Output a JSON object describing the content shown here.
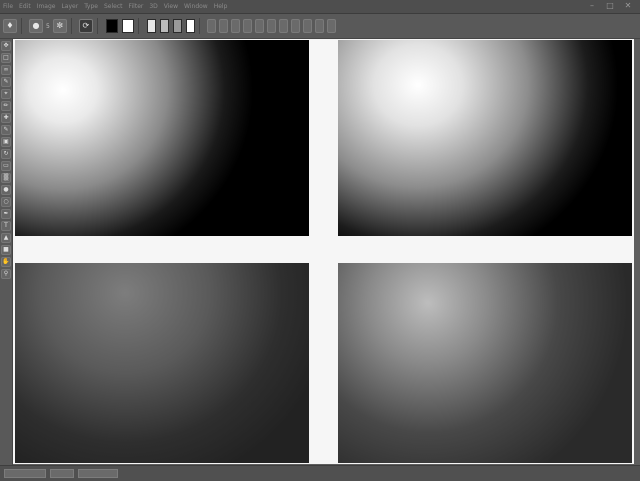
{
  "menubar": {
    "items": [
      "File",
      "Edit",
      "Image",
      "Layer",
      "Type",
      "Select",
      "Filter",
      "3D",
      "View",
      "Window",
      "Help"
    ]
  },
  "window_controls": {
    "minimize": "–",
    "maximize": "□",
    "close": "✕"
  },
  "optionsbar": {
    "tool_icon": "brush-icon",
    "size_label": "5",
    "swatches": {
      "foreground": "#ffffff",
      "background": "#000000"
    }
  },
  "toolbar": {
    "tools": [
      "move",
      "marquee",
      "lasso",
      "quick-select",
      "crop",
      "eyedropper",
      "healing",
      "brush",
      "stamp",
      "history",
      "eraser",
      "gradient",
      "blur",
      "dodge",
      "pen",
      "type",
      "path-select",
      "shape",
      "hand",
      "zoom"
    ]
  },
  "canvas": {
    "panels": [
      "top-left",
      "top-right",
      "bottom-left",
      "bottom-right"
    ],
    "background": "#f6f6f6"
  },
  "statusbar": {
    "tabs": [
      "",
      "",
      ""
    ]
  }
}
